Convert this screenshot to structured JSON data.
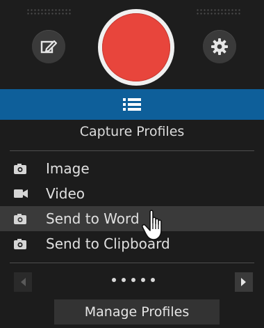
{
  "toolbar": {
    "edit_icon": "edit-icon",
    "record_icon": "record-icon",
    "settings_icon": "gear-icon",
    "record_color": "#e8453c"
  },
  "header": {
    "menu_icon": "list-icon",
    "bar_color": "#0e5f9a",
    "title": "Capture Profiles"
  },
  "profiles": [
    {
      "label": "Image",
      "icon": "camera-icon"
    },
    {
      "label": "Video",
      "icon": "video-camera-icon"
    },
    {
      "label": "Send to Word",
      "icon": "camera-icon",
      "hovered": true
    },
    {
      "label": "Send to Clipboard",
      "icon": "camera-icon"
    }
  ],
  "pager": {
    "pages": 5
  },
  "footer": {
    "manage_label": "Manage Profiles"
  }
}
